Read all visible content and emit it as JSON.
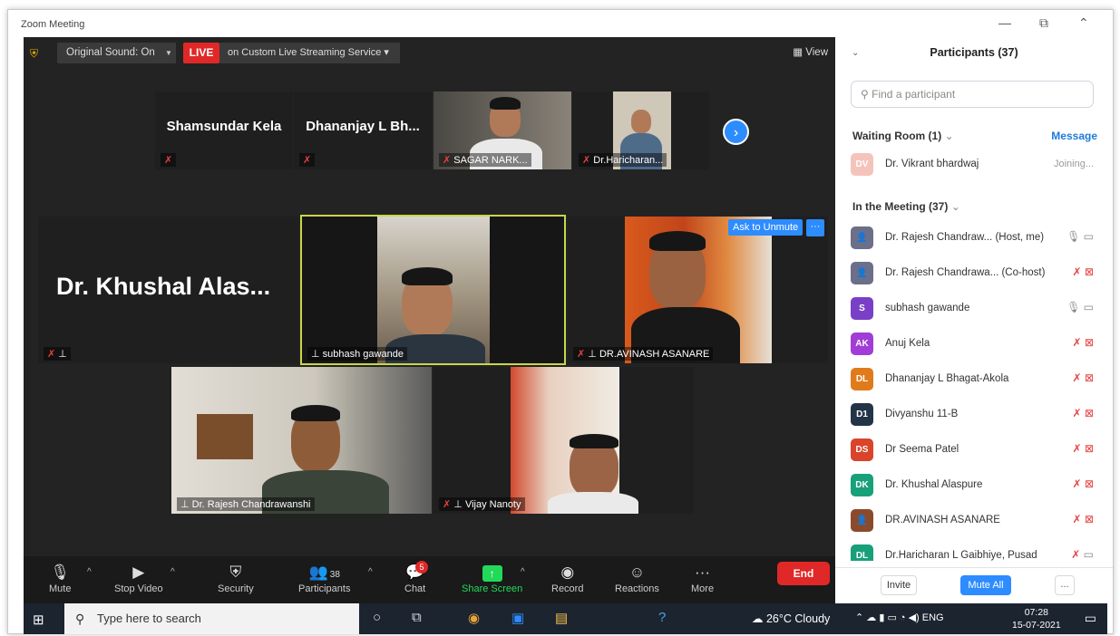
{
  "window": {
    "title": "Zoom Meeting",
    "controls": {
      "minimize": "—",
      "restore": "⧉",
      "collapse": "⌃"
    }
  },
  "topbar": {
    "original_sound": "Original Sound: On",
    "live": "LIVE",
    "streaming": "on Custom Live Streaming Service",
    "view": "View"
  },
  "strip": {
    "tiles": [
      {
        "name": "Shamsundar Kela"
      },
      {
        "name": "Dhananjay L Bh..."
      },
      {
        "name": "SAGAR NARK..."
      },
      {
        "name": "Dr.Haricharan..."
      }
    ]
  },
  "gallery": {
    "khushal_name": "Dr. Khushal Alas...",
    "subhash_label": "subhash gawande",
    "avinash_label": "DR.AVINASH ASANARE",
    "ask_to_unmute": "Ask to Unmute",
    "more": "···",
    "rajesh_label": "Dr. Rajesh Chandrawanshi",
    "vijay_label": "Vijay Nanoty"
  },
  "toolbar": {
    "mute": "Mute",
    "stop_video": "Stop Video",
    "security": "Security",
    "participants": "Participants",
    "participants_count": "38",
    "chat": "Chat",
    "chat_badge": "5",
    "share_screen": "Share Screen",
    "record": "Record",
    "reactions": "Reactions",
    "more": "More",
    "end": "End"
  },
  "panel": {
    "title": "Participants (37)",
    "search_placeholder": "Find a participant",
    "waiting_room": "Waiting Room (1)",
    "message": "Message",
    "waiting": [
      {
        "initials": "DV",
        "name": "Dr. Vikrant bhardwaj",
        "status": "Joining...",
        "color": "#f4c4bb"
      }
    ],
    "in_meeting": "In the Meeting (37)",
    "participants": [
      {
        "initials": "",
        "name": "Dr. Rajesh Chandraw... (Host, me)",
        "color": "#6b6f8a",
        "mic": "on",
        "video": "on"
      },
      {
        "initials": "",
        "name": "Dr. Rajesh Chandrawa... (Co-host)",
        "color": "#6b6f8a",
        "mic": "off",
        "video": "off"
      },
      {
        "initials": "S",
        "name": "subhash gawande",
        "color": "#7a3fc7",
        "mic": "on",
        "video": "on"
      },
      {
        "initials": "AK",
        "name": "Anuj Kela",
        "color": "#a13dd6",
        "mic": "off",
        "video": "off"
      },
      {
        "initials": "DL",
        "name": "Dhananjay L Bhagat-Akola",
        "color": "#e07b1c",
        "mic": "off",
        "video": "off"
      },
      {
        "initials": "D1",
        "name": "Divyanshu 11-B",
        "color": "#243447",
        "mic": "off",
        "video": "off"
      },
      {
        "initials": "DS",
        "name": "Dr Seema Patel",
        "color": "#d9442a",
        "mic": "off",
        "video": "off"
      },
      {
        "initials": "DK",
        "name": "Dr. Khushal Alaspure",
        "color": "#17a07a",
        "mic": "off",
        "video": "off"
      },
      {
        "initials": "",
        "name": "DR.AVINASH ASANARE",
        "color": "#8a4b2c",
        "mic": "off",
        "video": "off"
      },
      {
        "initials": "DL",
        "name": "Dr.Haricharan L Gaibhiye, Pusad",
        "color": "#17a07a",
        "mic": "off",
        "video": "on"
      }
    ],
    "invite": "Invite",
    "mute_all": "Mute All",
    "more": "..."
  },
  "taskbar": {
    "search_placeholder": "Type here to search",
    "weather": "26°C  Cloudy",
    "lang": "ENG",
    "time": "07:28",
    "date": "15-07-2021"
  },
  "colors": {
    "accent": "#2d8cff",
    "live_red": "#e02828",
    "share_green": "#23d959",
    "active_speaker": "#c8d64a"
  }
}
